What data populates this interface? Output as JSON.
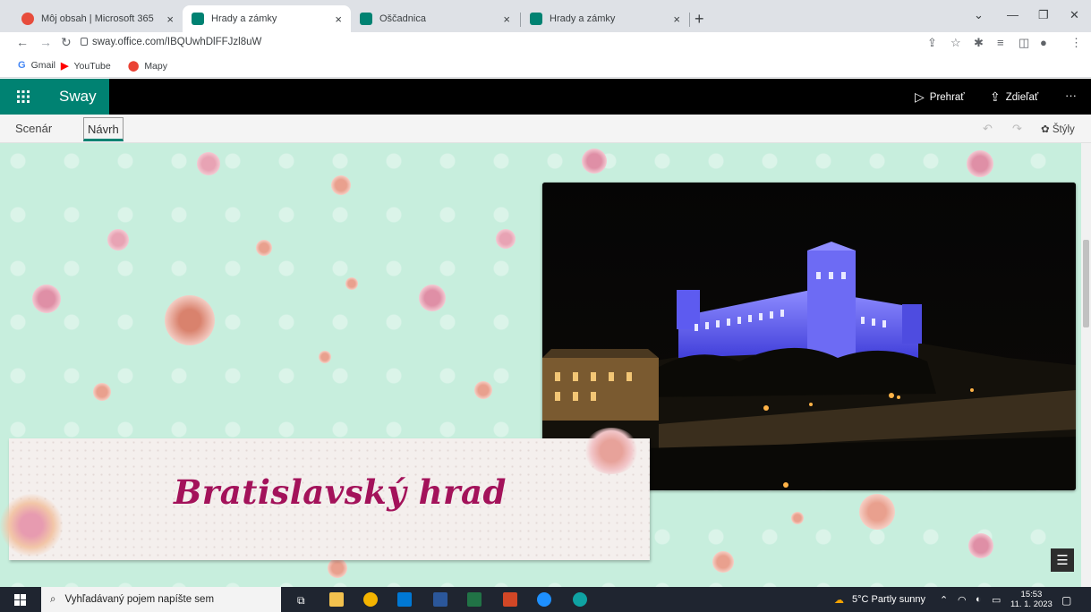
{
  "browser": {
    "tabs": [
      {
        "label": "Môj obsah | Microsoft 365",
        "active": false
      },
      {
        "label": "Hrady a zámky",
        "active": true
      },
      {
        "label": "Oščadnica",
        "active": false
      },
      {
        "label": "Hrady a zámky",
        "active": false
      }
    ],
    "close_glyph": "×",
    "new_tab_glyph": "+",
    "url": "sway.office.com/IBQUwhDlFFJzl8uW",
    "bookmarks": [
      {
        "label": "Gmail",
        "icon": "gmail-icon"
      },
      {
        "label": "YouTube",
        "icon": "youtube-icon"
      },
      {
        "label": "Mapy",
        "icon": "maps-icon"
      }
    ]
  },
  "sway": {
    "brand": "Sway",
    "play_label": "Prehrať",
    "share_label": "Zdieľať",
    "more_label": "···",
    "tabs": {
      "storyline": "Scenár",
      "design": "Návrh"
    },
    "styles_label": "Štýly",
    "title": "Bratislavský hrad"
  },
  "taskbar": {
    "search_placeholder": "Vyhľadávaný pojem napíšte sem",
    "weather": "5°C  Partly sunny",
    "time": "15:53",
    "date": "11. 1. 2023"
  },
  "colors": {
    "sway_accent": "#008272",
    "title_color": "#a3125a",
    "canvas_bg": "#c7eedd"
  }
}
